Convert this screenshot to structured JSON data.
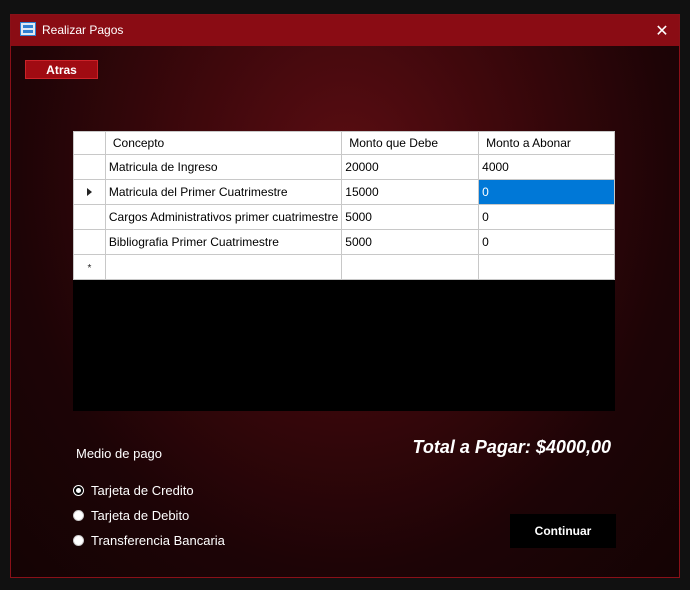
{
  "window": {
    "title": "Realizar Pagos",
    "icon": "app-form-icon",
    "close_icon": "close-icon"
  },
  "toolbar": {
    "back_label": "Atras"
  },
  "grid": {
    "headers": [
      "Concepto",
      "Monto que Debe",
      "Monto a Abonar"
    ],
    "rows": [
      {
        "concepto": "Matricula de Ingreso",
        "monto_debe": "20000",
        "monto_abonar": "4000"
      },
      {
        "concepto": "Matricula del Primer Cuatrimestre",
        "monto_debe": "15000",
        "monto_abonar": "0"
      },
      {
        "concepto": "Cargos Administrativos primer cuatrimestre",
        "monto_debe": "5000",
        "monto_abonar": "0"
      },
      {
        "concepto": "Bibliografia Primer Cuatrimestre",
        "monto_debe": "5000",
        "monto_abonar": "0"
      }
    ],
    "current_row_index": 1,
    "selected_cell": "Monto a Abonar",
    "new_row_marker": "*"
  },
  "payment": {
    "label": "Medio de pago",
    "options": [
      "Tarjeta de Credito",
      "Tarjeta de Debito",
      "Transferencia Bancaria"
    ],
    "selected": "Tarjeta de Credito"
  },
  "total_label": "Total a Pagar: $4000,00",
  "continue_label": "Continuar",
  "colors": {
    "titlebar": "#8a0c14",
    "accent_button": "#a00b12",
    "selection": "#0078d7"
  }
}
